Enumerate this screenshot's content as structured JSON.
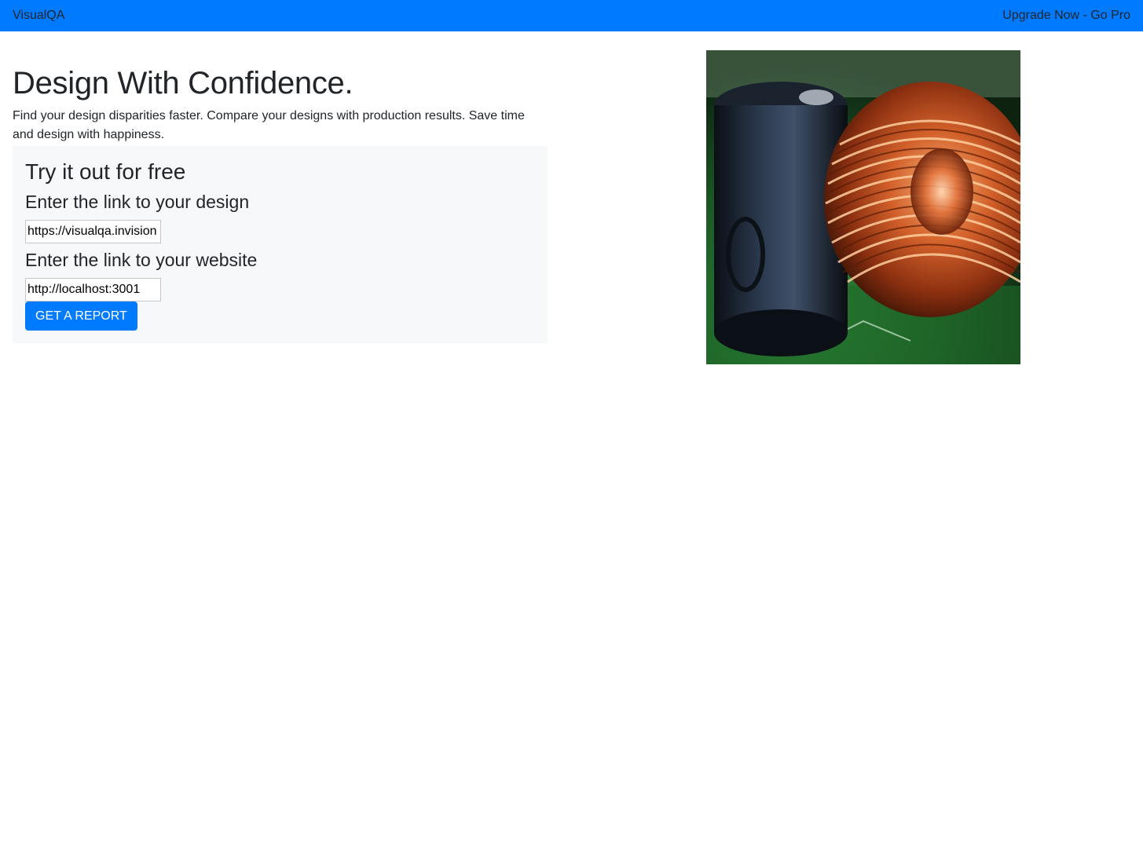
{
  "navbar": {
    "brand": "VisualQA",
    "upgrade_link": "Upgrade Now - Go Pro",
    "background_color": "#007bff"
  },
  "hero": {
    "title": "Design With Confidence.",
    "description": "Find your design disparities faster. Compare your designs with production results. Save time and design with happiness."
  },
  "form": {
    "heading": "Try it out for free",
    "design_label": "Enter the link to your design",
    "design_value": "https://visualqa.invision",
    "website_label": "Enter the link to your website",
    "website_value": "http://localhost:3001",
    "submit_label": "GET A REPORT"
  },
  "image": {
    "subject": "toroidal-inductor-photo"
  }
}
